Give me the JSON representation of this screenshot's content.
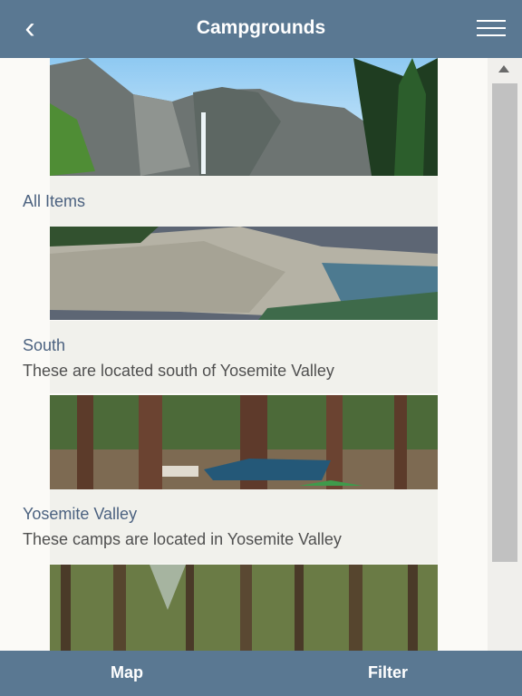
{
  "header": {
    "title": "Campgrounds",
    "back_icon": "chevron-left-icon",
    "menu_icon": "hamburger-menu-icon"
  },
  "items": [
    {
      "label": "All Items",
      "description": ""
    },
    {
      "label": "South",
      "description": "These are located south of Yosemite Valley"
    },
    {
      "label": "Yosemite Valley",
      "description": "These camps are located in Yosemite Valley"
    }
  ],
  "footer": {
    "map_label": "Map",
    "filter_label": "Filter"
  },
  "colors": {
    "bar": "#5a7892",
    "label": "#4c6280",
    "scroll_thumb": "#c1c1c1"
  }
}
